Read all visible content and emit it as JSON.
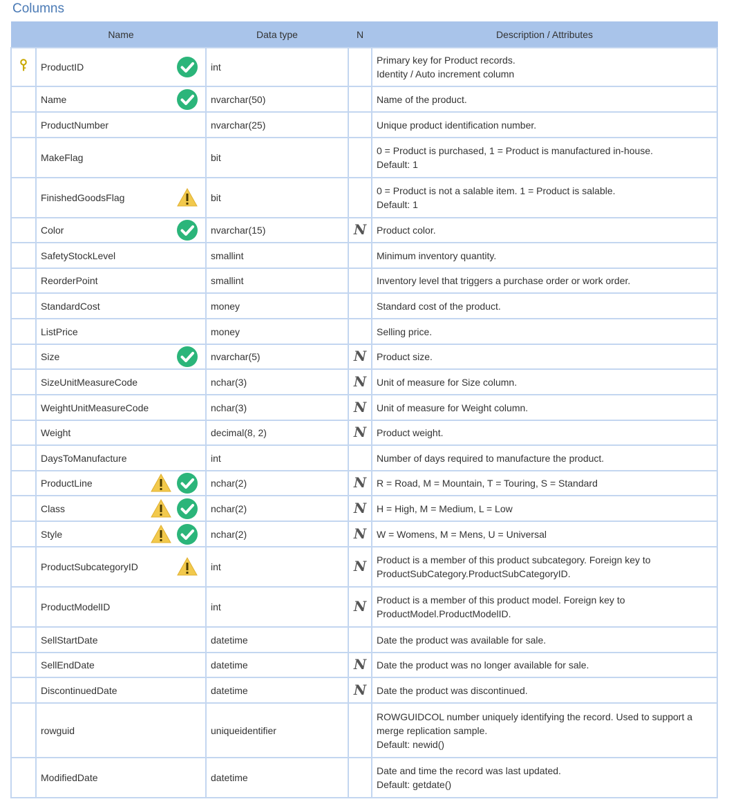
{
  "section_title": "Columns",
  "headers": {
    "name": "Name",
    "data_type": "Data type",
    "n": "N",
    "description": "Description / Attributes"
  },
  "colors": {
    "header_bg": "#a9c4ea",
    "border": "#c3d6f0",
    "check": "#2bb57a",
    "warning": "#f2c94c",
    "key": "#c8a800"
  },
  "rows": [
    {
      "name": "ProductID",
      "type": "int",
      "nullable": "",
      "key": true,
      "icons": [
        "check-icon"
      ],
      "desc": [
        "Primary key for Product records.",
        "Identity / Auto increment column"
      ],
      "height": 56
    },
    {
      "name": "Name",
      "type": "nvarchar(50)",
      "nullable": "",
      "key": false,
      "icons": [
        "check-icon"
      ],
      "desc": [
        "Name of the product."
      ],
      "height": 37
    },
    {
      "name": "ProductNumber",
      "type": "nvarchar(25)",
      "nullable": "",
      "key": false,
      "icons": [],
      "desc": [
        "Unique product identification number."
      ],
      "height": 37
    },
    {
      "name": "MakeFlag",
      "type": "bit",
      "nullable": "",
      "key": false,
      "icons": [],
      "desc": [
        "0 = Product is purchased, 1 = Product is manufactured in-house.",
        "Default: 1"
      ],
      "height": 58
    },
    {
      "name": "FinishedGoodsFlag",
      "type": "bit",
      "nullable": "",
      "key": false,
      "icons": [
        "warning-icon"
      ],
      "desc": [
        "0 = Product is not a salable item. 1 = Product is salable.",
        "Default: 1"
      ],
      "height": 58
    },
    {
      "name": "Color",
      "type": "nvarchar(15)",
      "nullable": "N",
      "key": false,
      "icons": [
        "check-icon"
      ],
      "desc": [
        "Product color."
      ],
      "height": 36
    },
    {
      "name": "SafetyStockLevel",
      "type": "smallint",
      "nullable": "",
      "key": false,
      "icons": [],
      "desc": [
        "Minimum inventory quantity."
      ],
      "height": 37
    },
    {
      "name": "ReorderPoint",
      "type": "smallint",
      "nullable": "",
      "key": false,
      "icons": [],
      "desc": [
        "Inventory level that triggers a purchase order or work order."
      ],
      "height": 36
    },
    {
      "name": "StandardCost",
      "type": "money",
      "nullable": "",
      "key": false,
      "icons": [],
      "desc": [
        "Standard cost of the product."
      ],
      "height": 37
    },
    {
      "name": "ListPrice",
      "type": "money",
      "nullable": "",
      "key": false,
      "icons": [],
      "desc": [
        "Selling price."
      ],
      "height": 37
    },
    {
      "name": "Size",
      "type": "nvarchar(5)",
      "nullable": "N",
      "key": false,
      "icons": [
        "check-icon"
      ],
      "desc": [
        "Product size."
      ],
      "height": 36
    },
    {
      "name": "SizeUnitMeasureCode",
      "type": "nchar(3)",
      "nullable": "N",
      "key": false,
      "icons": [],
      "desc": [
        "Unit of measure for Size column."
      ],
      "height": 37
    },
    {
      "name": "WeightUnitMeasureCode",
      "type": "nchar(3)",
      "nullable": "N",
      "key": false,
      "icons": [],
      "desc": [
        "Unit of measure for Weight column."
      ],
      "height": 37
    },
    {
      "name": "Weight",
      "type": "decimal(8, 2)",
      "nullable": "N",
      "key": false,
      "icons": [],
      "desc": [
        "Product weight."
      ],
      "height": 36
    },
    {
      "name": "DaysToManufacture",
      "type": "int",
      "nullable": "",
      "key": false,
      "icons": [],
      "desc": [
        "Number of days required to manufacture the product."
      ],
      "height": 37
    },
    {
      "name": "ProductLine",
      "type": "nchar(2)",
      "nullable": "N",
      "key": false,
      "icons": [
        "warning-icon",
        "check-icon"
      ],
      "desc": [
        "R = Road, M = Mountain, T = Touring, S = Standard"
      ],
      "height": 36
    },
    {
      "name": "Class",
      "type": "nchar(2)",
      "nullable": "N",
      "key": false,
      "icons": [
        "warning-icon",
        "check-icon"
      ],
      "desc": [
        "H = High, M = Medium, L = Low"
      ],
      "height": 37
    },
    {
      "name": "Style",
      "type": "nchar(2)",
      "nullable": "N",
      "key": false,
      "icons": [
        "warning-icon",
        "check-icon"
      ],
      "desc": [
        "W = Womens, M = Mens, U = Universal"
      ],
      "height": 37
    },
    {
      "name": "ProductSubcategoryID",
      "type": "int",
      "nullable": "N",
      "key": false,
      "icons": [
        "warning-icon"
      ],
      "desc": [
        "Product is a member of this product subcategory. Foreign key to",
        "ProductSubCategory.ProductSubCategoryID."
      ],
      "height": 58
    },
    {
      "name": "ProductModelID",
      "type": "int",
      "nullable": "N",
      "key": false,
      "icons": [],
      "desc": [
        "Product is a member of this product model. Foreign key to",
        "ProductModel.ProductModelID."
      ],
      "height": 58
    },
    {
      "name": "SellStartDate",
      "type": "datetime",
      "nullable": "",
      "key": false,
      "icons": [],
      "desc": [
        "Date the product was available for sale."
      ],
      "height": 37
    },
    {
      "name": "SellEndDate",
      "type": "datetime",
      "nullable": "N",
      "key": false,
      "icons": [],
      "desc": [
        "Date the product was no longer available for sale."
      ],
      "height": 36
    },
    {
      "name": "DiscontinuedDate",
      "type": "datetime",
      "nullable": "N",
      "key": false,
      "icons": [],
      "desc": [
        "Date the product was discontinued."
      ],
      "height": 37
    },
    {
      "name": "rowguid",
      "type": "uniqueidentifier",
      "nullable": "",
      "key": false,
      "icons": [],
      "desc": [
        "ROWGUIDCOL number uniquely identifying the record. Used to support a",
        "merge replication sample.",
        "Default: newid()"
      ],
      "height": 79
    },
    {
      "name": "ModifiedDate",
      "type": "datetime",
      "nullable": "",
      "key": false,
      "icons": [],
      "desc": [
        "Date and time the record was last updated.",
        "Default: getdate()"
      ],
      "height": 58
    }
  ]
}
